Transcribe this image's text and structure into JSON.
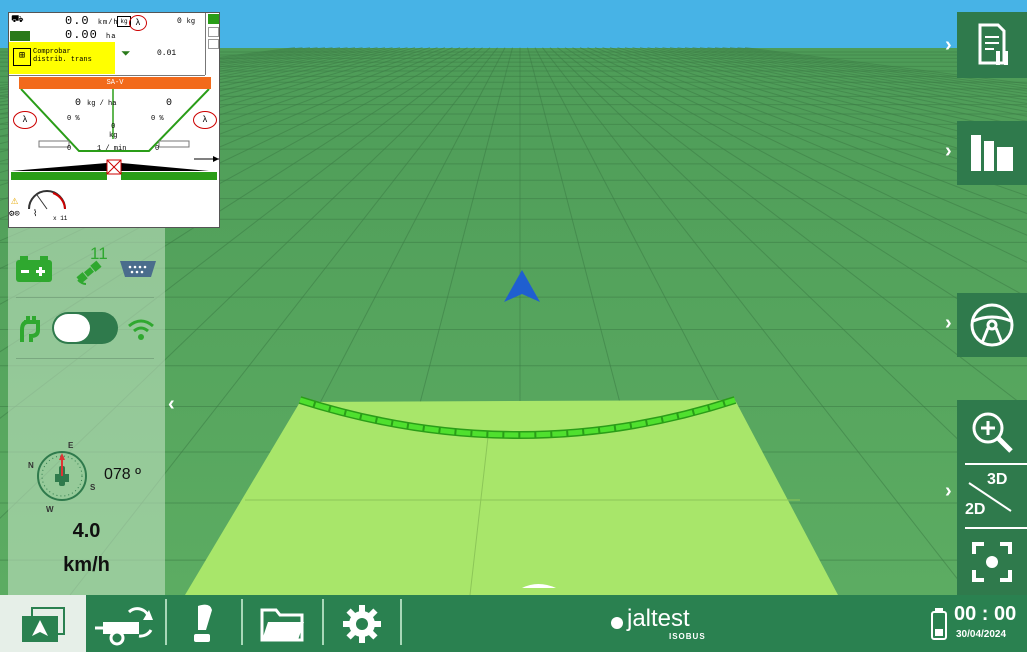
{
  "isobus": {
    "speed_value": "0.0",
    "speed_unit": "km/h",
    "area_value": "0.00",
    "area_unit": "ha",
    "weight_value": "0",
    "weight_unit": "kg",
    "kg_box_label": "kg",
    "warning_text_1": "Comprobar",
    "warning_text_2": "distrib. trans",
    "rate_value": "0.01",
    "title_bar": "SA-V",
    "dose_value": "0",
    "dose_unit": "kg / ha",
    "right_value": "0",
    "left_pct_value": "0",
    "left_pct_unit": "%",
    "right_pct_value": "0",
    "right_pct_unit": "%",
    "center_value": "0",
    "center_unit": "kg",
    "left_flow_value": "0",
    "rpm_unit": "1 / min",
    "right_flow_value": "0",
    "multiplier": "x 11",
    "lambda_label": "λ"
  },
  "status": {
    "satellites": "11",
    "heading": "078 º",
    "compass_n": "N",
    "compass_e": "E",
    "compass_s": "S",
    "compass_w": "W",
    "speed_value": "4.0",
    "speed_unit": "km/h"
  },
  "toolbar": {
    "mode_3d": "3D",
    "mode_2d": "2D"
  },
  "bottom": {
    "brand_name": "jaltest",
    "brand_sub": "ISOBUS",
    "clock": "00 : 00",
    "date": "30/04/2024"
  },
  "colors": {
    "sky": "#47b3e6",
    "field": "#5aa860",
    "coverage": "#a8e66a",
    "boom": "#3fd12a",
    "toolbar": "#2f7a4c",
    "bottom_bar": "#2a8150",
    "vehicle_arrow": "#1f5fd0",
    "isobus_orange": "#f26a1b",
    "warning_yellow": "#ffff00"
  }
}
